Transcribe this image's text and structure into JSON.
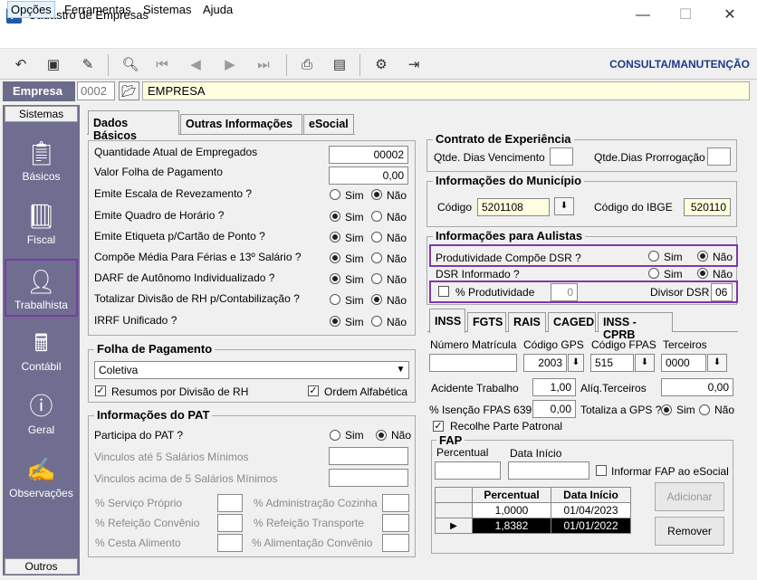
{
  "window": {
    "title": "Cadastro de Empresas",
    "app_icon": "P",
    "minimize": "—",
    "maximize": "☐",
    "close": "✕"
  },
  "menu": [
    "Opções",
    "Ferramentas",
    "Sistemas",
    "Ajuda"
  ],
  "toolbar": {
    "mode": "CONSULTA/MANUTENÇÃO"
  },
  "empresa": {
    "label": "Empresa",
    "code": "0002",
    "name": "EMPRESA"
  },
  "sidebar": {
    "header": "Sistemas",
    "footer": "Outros",
    "items": [
      {
        "label": "Básicos",
        "icon": "basicos-icon"
      },
      {
        "label": "Fiscal",
        "icon": "fiscal-icon"
      },
      {
        "label": "Trabalhista",
        "icon": "trabalhista-icon"
      },
      {
        "label": "Contábil",
        "icon": "contabil-icon"
      },
      {
        "label": "Geral",
        "icon": "geral-icon"
      },
      {
        "label": "Observações",
        "icon": "observacoes-icon"
      }
    ]
  },
  "tabs": [
    "Dados Básicos",
    "Outras Informações",
    "eSocial"
  ],
  "dados": {
    "qtd_empregados_label": "Quantidade Atual de Empregados",
    "qtd_empregados": "00002",
    "valor_folha_label": "Valor Folha de Pagamento",
    "valor_folha": "0,00",
    "questions": [
      {
        "label": "Emite Escala de Revezamento ?",
        "value": "Não"
      },
      {
        "label": "Emite Quadro de Horário ?",
        "value": "Sim"
      },
      {
        "label": "Emite Etiqueta p/Cartão de Ponto ?",
        "value": "Sim"
      },
      {
        "label": "Compõe Média Para Férias e 13º Salário ?",
        "value": "Sim"
      },
      {
        "label": "DARF de Autônomo Individualizado ?",
        "value": "Sim"
      },
      {
        "label": "Totalizar Divisão de RH p/Contabilização ?",
        "value": "Não"
      },
      {
        "label": "IRRF Unificado ?",
        "value": "Sim"
      }
    ],
    "sim": "Sim",
    "nao": "Não"
  },
  "folha": {
    "title": "Folha de Pagamento",
    "tipo": "Coletiva",
    "resumos_label": "Resumos por Divisão de RH",
    "resumos": true,
    "ordem_label": "Ordem Alfabética",
    "ordem": true
  },
  "pat": {
    "title": "Informações do PAT",
    "participa_label": "Participa do PAT ?",
    "participa": "Não",
    "vinc5_label": "Vinculos até 5 Salários Mínimos",
    "vinc5acima_label": "Vinculos acima de 5 Salários Mínimos",
    "servico_label": "% Serviço Próprio",
    "adm_cozinha_label": "% Administração Cozinha",
    "ref_convenio_label": "% Refeição Convênio",
    "ref_transporte_label": "% Refeição Transporte",
    "cesta_label": "% Cesta Alimento",
    "alim_convenio_label": "% Alimentação Convênio"
  },
  "contrato": {
    "title": "Contrato de Experiência",
    "dias_venc_label": "Qtde. Dias Vencimento",
    "dias_prorrog_label": "Qtde.Dias Prorrogação"
  },
  "municipio": {
    "title": "Informações do Município",
    "codigo_label": "Código",
    "codigo": "5201108",
    "ibge_label": "Código do IBGE",
    "ibge": "520110"
  },
  "aulistas": {
    "title": "Informações para Aulistas",
    "prod_dsr_label": "Produtividade Compõe DSR ?",
    "prod_dsr": "Não",
    "dsr_inf_label": "DSR Informado ?",
    "dsr_inf": "Não",
    "pct_prod_label": "% Produtividade",
    "pct_prod": "0",
    "divisor_label": "Divisor DSR",
    "divisor": "06"
  },
  "tabs2": [
    "INSS",
    "FGTS",
    "RAIS",
    "CAGED",
    "INSS - CPRB"
  ],
  "inss": {
    "matricula_label": "Número Matrícula",
    "matricula": "",
    "gps_label": "Código GPS",
    "gps": "2003",
    "fpas_label": "Código FPAS",
    "fpas": "515",
    "terceiros_label": "Terceiros",
    "terceiros": "0000",
    "acidente_label": "Acidente Trabalho",
    "acidente": "1,00",
    "aliq_label": "Alíq.Terceiros",
    "aliq": "0,00",
    "isencao_label": "% Isenção FPAS 639",
    "isencao": "0,00",
    "totaliza_label": "Totaliza a GPS ?",
    "totaliza": "Sim",
    "recolhe_label": "Recolhe Parte Patronal",
    "recolhe": true
  },
  "fap": {
    "title": "FAP",
    "percentual_label": "Percentual",
    "data_label": "Data Início",
    "informar_label": "Informar FAP ao eSocial",
    "col_percentual": "Percentual",
    "col_data": "Data Início",
    "rows": [
      {
        "percentual": "1,0000",
        "data": "01/04/2023"
      },
      {
        "percentual": "1,8382",
        "data": "01/01/2022"
      }
    ],
    "adicionar": "Adicionar",
    "remover": "Remover"
  }
}
